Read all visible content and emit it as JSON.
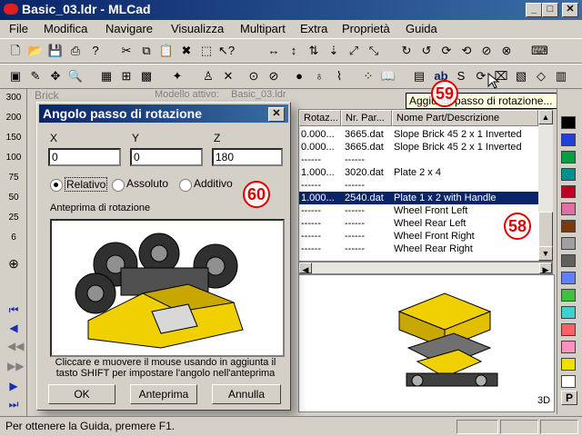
{
  "window": {
    "title": "Basic_03.ldr - MLCad"
  },
  "menu": [
    "File",
    "Modifica",
    "Navigare",
    "Visualizza",
    "Multipart",
    "Extra",
    "Proprietà",
    "Guida"
  ],
  "sidebar_zoom": [
    "300",
    "200",
    "150",
    "100",
    "75",
    "50",
    "25",
    "6"
  ],
  "panels": {
    "tree_label": "Brick",
    "model_label": "Modello attivo:",
    "model_value": "Basic_03.ldr"
  },
  "list": {
    "columns": [
      "Rotaz...",
      "Nr. Par...",
      "Nome Part/Descrizione"
    ],
    "rows": [
      {
        "rot": "0.000...",
        "part": "3665.dat",
        "desc": "Slope Brick 45  2 x  1 Inverted"
      },
      {
        "rot": "0.000...",
        "part": "3665.dat",
        "desc": "Slope Brick 45  2 x  1 Inverted"
      },
      {
        "rot": "------",
        "part": "------",
        "desc": ""
      },
      {
        "rot": "1.000...",
        "part": "3020.dat",
        "desc": "Plate  2 x  4"
      },
      {
        "rot": "------",
        "part": "------",
        "desc": ""
      },
      {
        "rot": "1.000...",
        "part": "2540.dat",
        "desc": "Plate  1 x  2 with Handle",
        "selected": true
      },
      {
        "rot": "------",
        "part": "------",
        "desc": "Wheel Front Left"
      },
      {
        "rot": "------",
        "part": "------",
        "desc": "Wheel Rear Left"
      },
      {
        "rot": "------",
        "part": "------",
        "desc": "Wheel Front Right"
      },
      {
        "rot": "------",
        "part": "------",
        "desc": "Wheel Rear Right"
      }
    ]
  },
  "tooltip": "Aggiungi passo di rotazione...",
  "view_label": "3D",
  "dialog": {
    "title": "Angolo passo di rotazione",
    "x_label": "X",
    "y_label": "Y",
    "z_label": "Z",
    "x_value": "0",
    "y_value": "0",
    "z_value": "180",
    "radio_relative": "Relativo",
    "radio_absolute": "Assoluto",
    "radio_additive": "Additivo",
    "preview_label": "Anteprima di rotazione",
    "hint": "Cliccare e muovere il mouse usando in aggiunta il tasto SHIFT per impostare l'angolo nell'anteprima",
    "ok": "OK",
    "preview_btn": "Anteprima",
    "cancel": "Annulla"
  },
  "markers": {
    "m58": "58",
    "m59": "59",
    "m60": "60"
  },
  "status": {
    "text": "Per ottenere la Guida, premere F1."
  },
  "palette_letter": "P",
  "colors": {
    "swatches": [
      "#000000",
      "#1e40e0",
      "#00a040",
      "#009090",
      "#c00020",
      "#e070a0",
      "#7a3a10",
      "#a0a0a0",
      "#606060",
      "#6080ff",
      "#40c040",
      "#40d0d0",
      "#ff6060",
      "#ff90c0",
      "#f0e000",
      "#ffffff"
    ]
  }
}
